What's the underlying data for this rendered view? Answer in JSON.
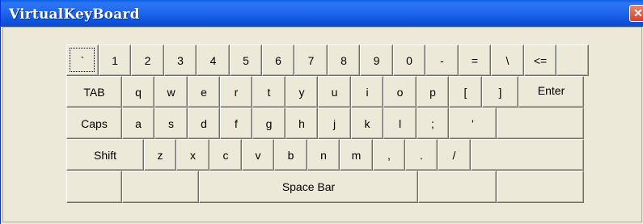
{
  "window": {
    "title": "VirtualKeyBoard",
    "close_label": "✕"
  },
  "keys": {
    "row1": [
      "`",
      "1",
      "2",
      "3",
      "4",
      "5",
      "6",
      "7",
      "8",
      "9",
      "0",
      "-",
      "=",
      "\\",
      "<=",
      ""
    ],
    "row2": [
      "TAB",
      "q",
      "w",
      "e",
      "r",
      "t",
      "y",
      "u",
      "i",
      "o",
      "p",
      "[",
      "]"
    ],
    "row3": [
      "Caps",
      "a",
      "s",
      "d",
      "f",
      "g",
      "h",
      "j",
      "k",
      "l",
      ";",
      "'"
    ],
    "row4": [
      "Shift",
      "z",
      "x",
      "c",
      "v",
      "b",
      "n",
      "m",
      ",",
      ".",
      "/",
      ""
    ],
    "row5": [
      "",
      "",
      "Space Bar",
      "",
      ""
    ],
    "enter": "Enter"
  }
}
